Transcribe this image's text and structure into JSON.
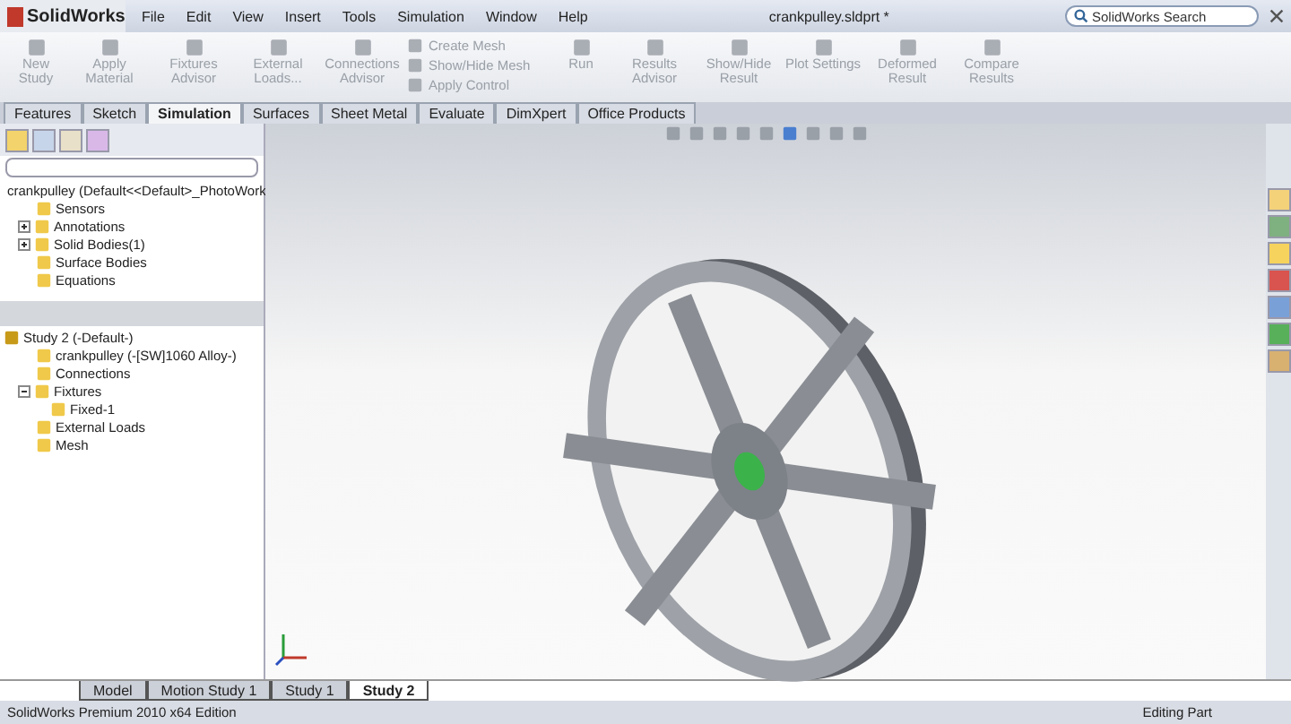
{
  "app": {
    "logo": "SolidWorks",
    "menu": [
      "File",
      "Edit",
      "View",
      "Insert",
      "Tools",
      "Simulation",
      "Window",
      "Help"
    ],
    "document_title": "crankpulley.sldprt *",
    "search": {
      "placeholder": "SolidWorks Search"
    }
  },
  "ribbon": [
    {
      "kind": "large",
      "label": "New Study",
      "disabled": true
    },
    {
      "kind": "large",
      "label": "Apply Material",
      "disabled": true
    },
    {
      "kind": "large",
      "label": "Fixtures Advisor",
      "disabled": true
    },
    {
      "kind": "large",
      "label": "External Loads...",
      "disabled": true
    },
    {
      "kind": "large",
      "label": "Connections Advisor",
      "disabled": true
    },
    {
      "kind": "stack",
      "items": [
        {
          "label": "Create Mesh",
          "disabled": true
        },
        {
          "label": "Show/Hide Mesh",
          "disabled": true
        },
        {
          "label": "Apply Control",
          "disabled": true
        }
      ]
    },
    {
      "kind": "large",
      "label": "Run",
      "disabled": true
    },
    {
      "kind": "large",
      "label": "Results Advisor",
      "disabled": true
    },
    {
      "kind": "large",
      "label": "Show/Hide Result",
      "disabled": true
    },
    {
      "kind": "large",
      "label": "Plot Settings",
      "disabled": true
    },
    {
      "kind": "large",
      "label": "Deformed Result",
      "disabled": true
    },
    {
      "kind": "large",
      "label": "Compare Results",
      "disabled": true
    }
  ],
  "command_tabs": [
    {
      "label": "Features",
      "selected": false
    },
    {
      "label": "Sketch",
      "selected": false
    },
    {
      "label": "Simulation",
      "selected": true
    },
    {
      "label": "Surfaces",
      "selected": false
    },
    {
      "label": "Sheet Metal",
      "selected": false
    },
    {
      "label": "Evaluate",
      "selected": false
    },
    {
      "label": "DimXpert",
      "selected": false
    },
    {
      "label": "Office Products",
      "selected": false
    }
  ],
  "feature_tree": {
    "label": "crankpulley  (Default<<Default>_PhotoWork",
    "children": [
      {
        "label": "Sensors"
      },
      {
        "label": "Annotations",
        "expanded": false
      },
      {
        "label": "Solid Bodies(1)",
        "expanded": false
      },
      {
        "label": "Surface Bodies"
      },
      {
        "label": "Equations"
      }
    ]
  },
  "study_tree": {
    "label": "Study 2 (-Default-)",
    "children": [
      {
        "label": "crankpulley (-[SW]1060 Alloy-)"
      },
      {
        "label": "Connections"
      },
      {
        "label": "Fixtures",
        "expanded": true,
        "children": [
          {
            "label": "Fixed-1"
          }
        ]
      },
      {
        "label": "External Loads"
      },
      {
        "label": "Mesh"
      }
    ]
  },
  "bottom_tabs": [
    {
      "label": "Model",
      "selected": false
    },
    {
      "label": "Motion Study 1",
      "selected": false
    },
    {
      "label": "Study 1",
      "selected": false
    },
    {
      "label": "Study 2",
      "selected": true
    }
  ],
  "status_bar": {
    "edition": "SolidWorks Premium 2010 x64 Edition",
    "mode": "Editing Part"
  }
}
